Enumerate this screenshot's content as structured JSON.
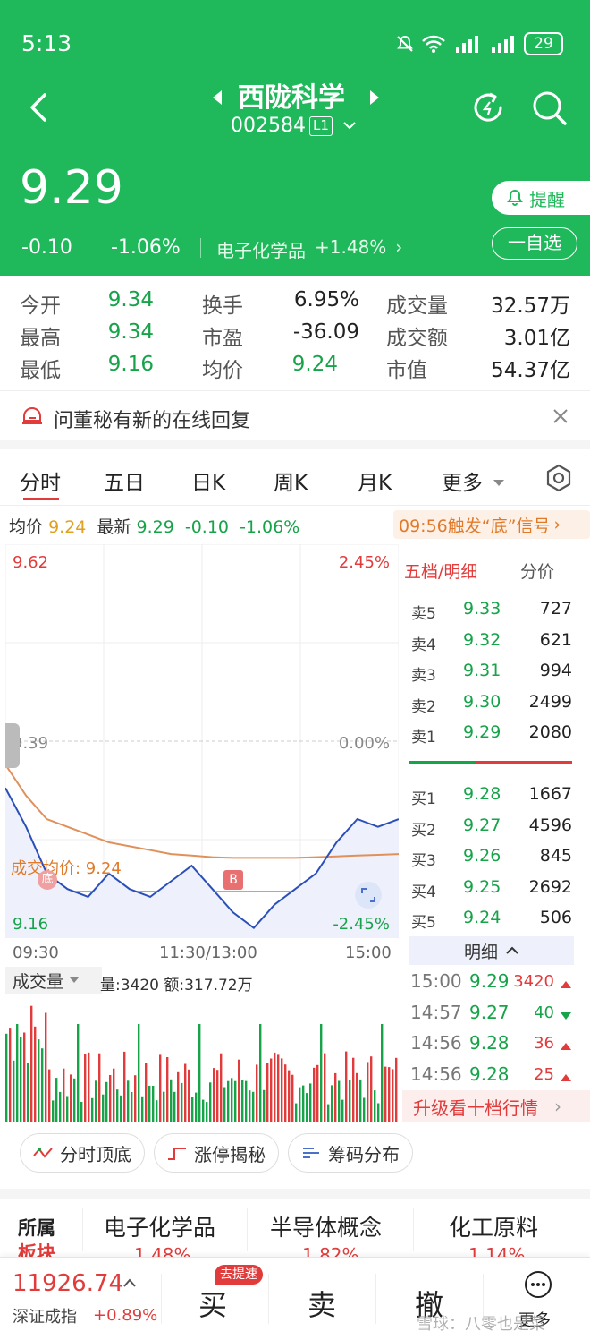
{
  "status_bar": {
    "time": "5:13",
    "battery": "29"
  },
  "stock": {
    "name": "西陇科学",
    "code": "002584",
    "level": "L1",
    "price": "9.29",
    "change": "-0.10",
    "change_pct": "-1.06%",
    "sector_name": "电子化学品",
    "sector_change": "+1.48%",
    "remind_label": "提醒",
    "watchlist_label": "一自选"
  },
  "stats": [
    {
      "label": "今开",
      "value": "9.34",
      "color": "green"
    },
    {
      "label": "换手",
      "value": "6.95%",
      "color": "black"
    },
    {
      "label": "成交量",
      "value": "32.57万",
      "color": "black"
    },
    {
      "label": "最高",
      "value": "9.34",
      "color": "green"
    },
    {
      "label": "市盈",
      "value": "-36.09",
      "color": "black"
    },
    {
      "label": "成交额",
      "value": "3.01亿",
      "color": "black"
    },
    {
      "label": "最低",
      "value": "9.16",
      "color": "green"
    },
    {
      "label": "均价",
      "value": "9.24",
      "color": "green"
    },
    {
      "label": "市值",
      "value": "54.37亿",
      "color": "black"
    }
  ],
  "notice": "问董秘有新的在线回复",
  "tabs": [
    "分时",
    "五日",
    "日K",
    "周K",
    "月K",
    "更多"
  ],
  "info_bar": {
    "avg_label": "均价",
    "avg_value": "9.24",
    "latest_label": "最新",
    "latest_value": "9.29",
    "change": "-0.10",
    "change_pct": "-1.06%",
    "signal": "09:56触发“底”信号"
  },
  "chart": {
    "y_top": "9.62",
    "y_top_pct": "2.45%",
    "y_mid": "9.39",
    "y_mid_pct": "0.00%",
    "y_bot": "9.16",
    "y_bot_pct": "-2.45%",
    "avg_line_label": "成交均价: 9.24",
    "x_start": "09:30",
    "x_mid": "11:30/13:00",
    "x_end": "15:00",
    "marker_bottom": "底",
    "marker_buy": "B"
  },
  "chart_data": {
    "type": "line",
    "series": [
      {
        "name": "成交均价",
        "values": [
          9.36,
          9.32,
          9.29,
          9.28,
          9.27,
          9.26,
          9.255,
          9.25,
          9.245,
          9.243,
          9.241,
          9.24,
          9.24,
          9.24,
          9.24,
          9.241,
          9.242,
          9.243,
          9.244,
          9.245
        ]
      }
    ],
    "price_values": [
      9.33,
      9.28,
      9.22,
      9.2,
      9.19,
      9.22,
      9.2,
      9.19,
      9.21,
      9.23,
      9.2,
      9.17,
      9.15,
      9.18,
      9.2,
      9.22,
      9.26,
      9.29,
      9.28,
      9.29
    ],
    "ylim": [
      9.16,
      9.62
    ]
  },
  "volume": {
    "label": "成交量",
    "info": "量:3420 额:317.72万"
  },
  "orderbook": {
    "tab1": "五档/明细",
    "tab2": "分价",
    "asks": [
      {
        "label": "卖5",
        "price": "9.33",
        "vol": "727"
      },
      {
        "label": "卖4",
        "price": "9.32",
        "vol": "621"
      },
      {
        "label": "卖3",
        "price": "9.31",
        "vol": "994"
      },
      {
        "label": "卖2",
        "price": "9.30",
        "vol": "2499"
      },
      {
        "label": "卖1",
        "price": "9.29",
        "vol": "2080"
      }
    ],
    "bids": [
      {
        "label": "买1",
        "price": "9.28",
        "vol": "1667"
      },
      {
        "label": "买2",
        "price": "9.27",
        "vol": "4596"
      },
      {
        "label": "买3",
        "price": "9.26",
        "vol": "845"
      },
      {
        "label": "买4",
        "price": "9.25",
        "vol": "2692"
      },
      {
        "label": "买5",
        "price": "9.24",
        "vol": "506"
      }
    ]
  },
  "detail": {
    "header": "明细",
    "rows": [
      {
        "time": "15:00",
        "price": "9.29",
        "vol": "3420",
        "dir": "up"
      },
      {
        "time": "14:57",
        "price": "9.27",
        "vol": "40",
        "dir": "down"
      },
      {
        "time": "14:56",
        "price": "9.28",
        "vol": "36",
        "dir": "up"
      },
      {
        "time": "14:56",
        "price": "9.28",
        "vol": "25",
        "dir": "up"
      }
    ],
    "upgrade": "升级看十档行情"
  },
  "chips": [
    "分时顶底",
    "涨停揭秘",
    "筹码分布"
  ],
  "sectors": {
    "label_line1": "所属",
    "label_line2": "板块",
    "items": [
      {
        "name": "电子化学品",
        "pct": "1.48%"
      },
      {
        "name": "半导体概念",
        "pct": "1.82%"
      },
      {
        "name": "化工原料",
        "pct": "1.14%"
      }
    ]
  },
  "bottom": {
    "index_value": "11926.74",
    "index_name": "深证成指",
    "index_pct": "+0.89%",
    "buy": "买",
    "buy_badge": "去提速",
    "sell": "卖",
    "cancel": "撤",
    "more": "更多",
    "watermark": "雪球：八零也是菜"
  }
}
